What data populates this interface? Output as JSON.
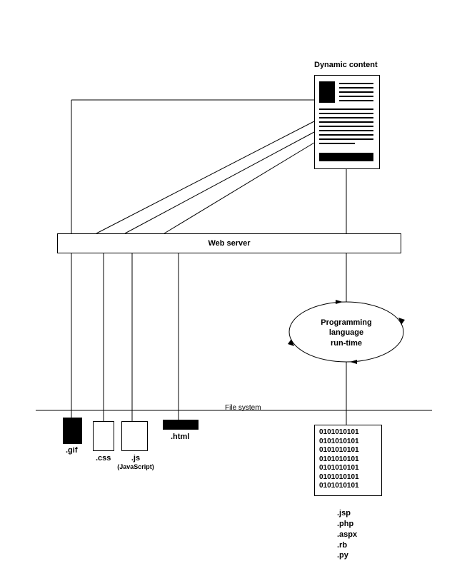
{
  "title_dynamic": "Dynamic content",
  "web_server": "Web server",
  "runtime": {
    "line1": "Programming",
    "line2": "language",
    "line3": "run-time"
  },
  "file_system": "File system",
  "files": {
    "gif": ".gif",
    "css": ".css",
    "js": ".js",
    "js_note": "(JavaScript)",
    "html": ".html"
  },
  "binary": {
    "row1": "0101010101",
    "row2": "0101010101",
    "row3": "0101010101",
    "row4": "0101010101",
    "row5": "0101010101",
    "row6": "0101010101",
    "row7": "0101010101"
  },
  "extensions": {
    "e1": ".jsp",
    "e2": ".php",
    "e3": ".aspx",
    "e4": ".rb",
    "e5": ".py"
  }
}
